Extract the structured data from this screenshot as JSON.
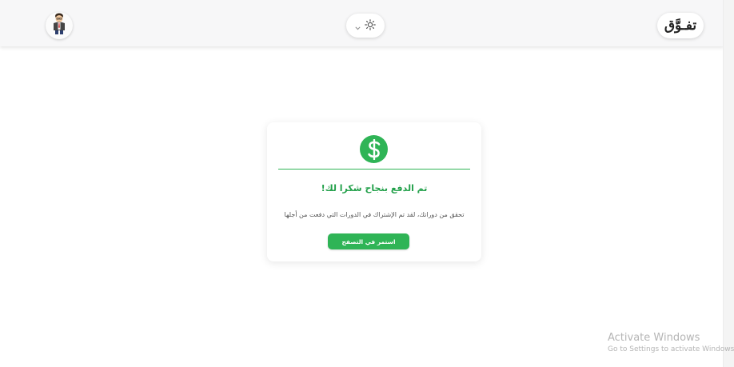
{
  "header": {
    "logo_text": "تفـوَّق",
    "avatar_icon": "user-avatar-icon",
    "theme_toggle": {
      "icon": "sun-icon",
      "chevron_icon": "chevron-down-icon"
    }
  },
  "payment_card": {
    "icon": "dollar-circle-icon",
    "title": "تم الدفع بنجاح شكرا لك!",
    "description": "تحقق من دوراتك، لقد تم الإشتراك في الدورات التي دفعت من أجلها",
    "continue_label": "استمر في التصفح"
  },
  "watermark": {
    "title": "Activate Windows",
    "subtitle": "Go to Settings to activate Windows."
  },
  "colors": {
    "accent_green": "#2fb456",
    "title_green": "#22a04a",
    "topbar_bg": "#f7f7f8"
  }
}
